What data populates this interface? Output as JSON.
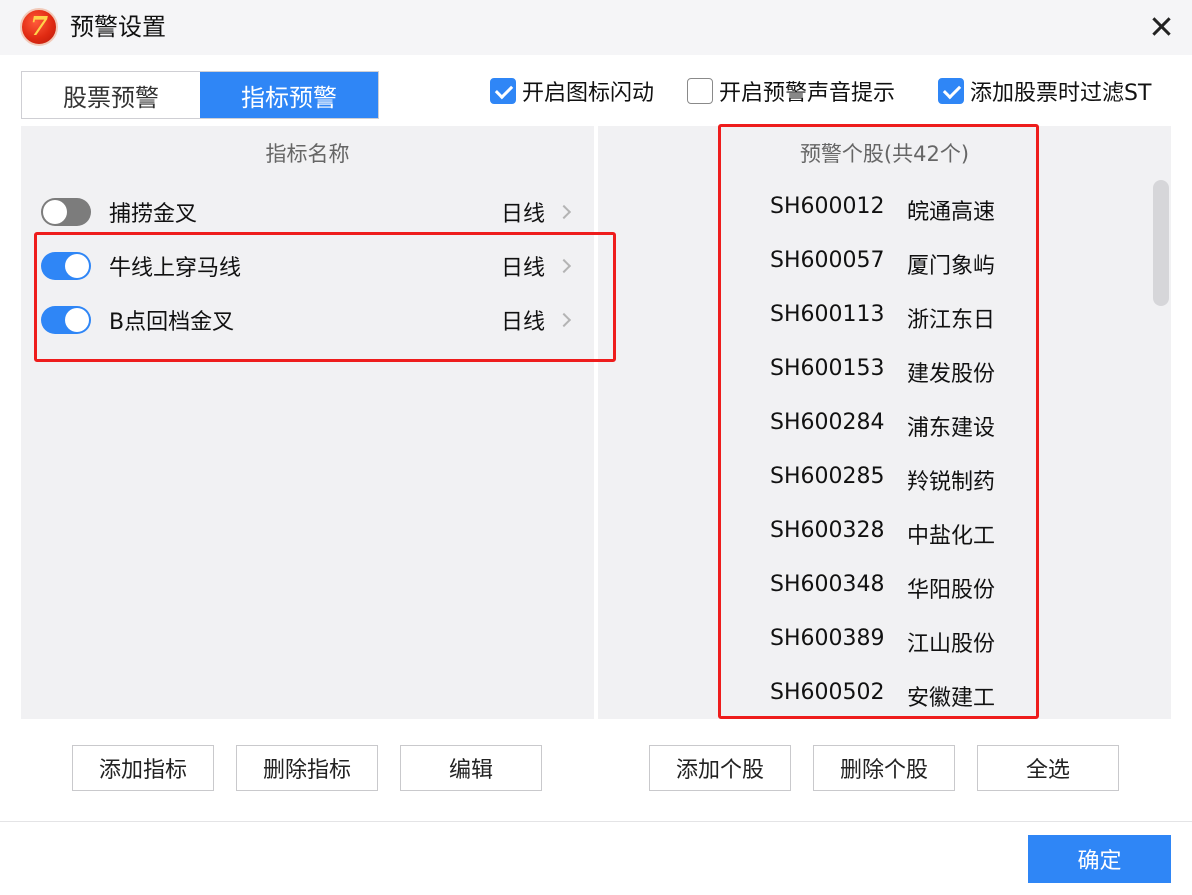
{
  "window": {
    "title": "预警设置",
    "logo_icon": "app-logo-icon",
    "logo_glyph": "7"
  },
  "tabs": [
    {
      "label": "股票预警",
      "active": false
    },
    {
      "label": "指标预警",
      "active": true
    }
  ],
  "options": [
    {
      "label": "开启图标闪动",
      "checked": true
    },
    {
      "label": "开启预警声音提示",
      "checked": false
    },
    {
      "label": "添加股票时过滤ST",
      "checked": true
    }
  ],
  "indicators": {
    "header": "指标名称",
    "items": [
      {
        "name": "捕捞金叉",
        "period": "日线",
        "enabled": false
      },
      {
        "name": "牛线上穿马线",
        "period": "日线",
        "enabled": true
      },
      {
        "name": "B点回档金叉",
        "period": "日线",
        "enabled": true
      }
    ]
  },
  "stocks": {
    "header": "预警个股(共42个)",
    "items": [
      {
        "code": "SH600012",
        "name": "皖通高速"
      },
      {
        "code": "SH600057",
        "name": "厦门象屿"
      },
      {
        "code": "SH600113",
        "name": "浙江东日"
      },
      {
        "code": "SH600153",
        "name": "建发股份"
      },
      {
        "code": "SH600284",
        "name": "浦东建设"
      },
      {
        "code": "SH600285",
        "name": "羚锐制药"
      },
      {
        "code": "SH600328",
        "name": "中盐化工"
      },
      {
        "code": "SH600348",
        "name": "华阳股份"
      },
      {
        "code": "SH600389",
        "name": "江山股份"
      },
      {
        "code": "SH600502",
        "name": "安徽建工"
      }
    ]
  },
  "buttons": {
    "add_indicator": "添加指标",
    "delete_indicator": "删除指标",
    "edit": "编辑",
    "add_stock": "添加个股",
    "delete_stock": "删除个股",
    "select_all": "全选",
    "confirm": "确定"
  },
  "colors": {
    "accent": "#2f86f6",
    "highlight": "#ee1c1c",
    "panel": "#f1f1f3"
  }
}
